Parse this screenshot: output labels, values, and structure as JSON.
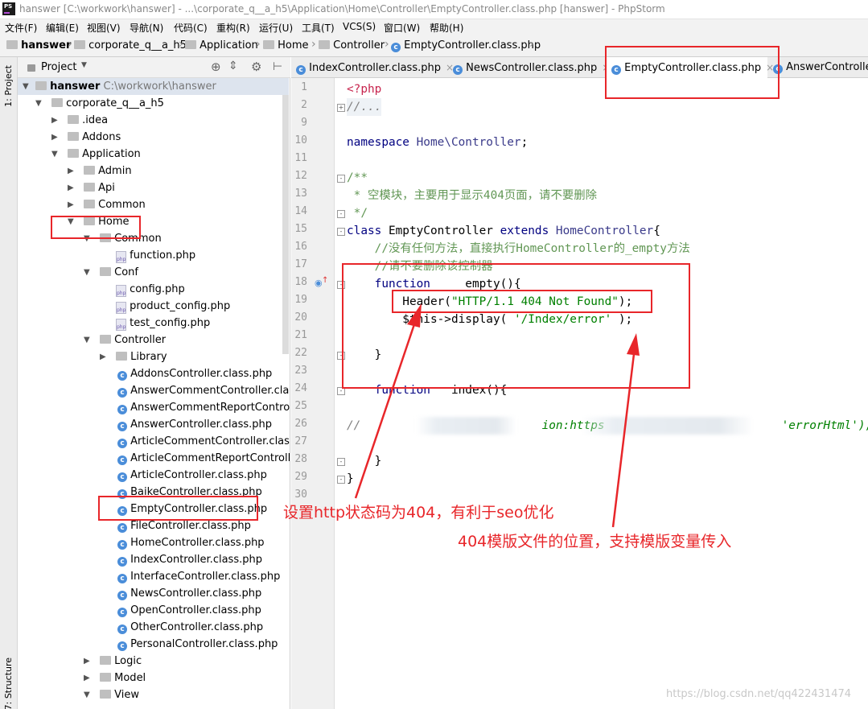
{
  "window": {
    "app_icon": "PS",
    "title": "hanswer [C:\\workwork\\hanswer] - ...\\corporate_q__a_h5\\Application\\Home\\Controller\\EmptyController.class.php [hanswer] - PhpStorm"
  },
  "menu": [
    "文件(F)",
    "编辑(E)",
    "视图(V)",
    "导航(N)",
    "代码(C)",
    "重构(R)",
    "运行(U)",
    "工具(T)",
    "VCS(S)",
    "窗口(W)",
    "帮助(H)"
  ],
  "breadcrumb": [
    "hanswer",
    "corporate_q__a_h5",
    "Application",
    "Home",
    "Controller",
    "EmptyController.class.php"
  ],
  "side_tabs": {
    "project": "1: Project",
    "structure": "7: Structure"
  },
  "project_panel": {
    "label": "Project",
    "dropdown_icon": "chevron-down-icon"
  },
  "tree": {
    "root": {
      "name": "hanswer",
      "path": "C:\\workwork\\hanswer"
    },
    "corporate": "corporate_q__a_h5",
    "idea": ".idea",
    "addons": "Addons",
    "application": "Application",
    "admin": "Admin",
    "api": "Api",
    "common": "Common",
    "home": "Home",
    "home_common": "Common",
    "function_php": "function.php",
    "conf": "Conf",
    "config_php": "config.php",
    "product_config_php": "product_config.php",
    "test_config_php": "test_config.php",
    "controller": "Controller",
    "library": "Library",
    "controllers": [
      "AddonsController.class.php",
      "AnswerCommentController.class.php",
      "AnswerCommentReportController.class.php",
      "AnswerController.class.php",
      "ArticleCommentController.class.php",
      "ArticleCommentReportController.class.php",
      "ArticleController.class.php",
      "BaikeController.class.php",
      "EmptyController.class.php",
      "FileController.class.php",
      "HomeController.class.php",
      "IndexController.class.php",
      "InterfaceController.class.php",
      "NewsController.class.php",
      "OpenController.class.php",
      "OtherController.class.php",
      "PersonalController.class.php"
    ],
    "logic": "Logic",
    "model": "Model",
    "view": "View"
  },
  "tabs": [
    {
      "label": "IndexController.class.php"
    },
    {
      "label": "NewsController.class.php"
    },
    {
      "label": "EmptyController.class.php",
      "active": true
    },
    {
      "label": "AnswerController."
    }
  ],
  "line_numbers": [
    "1",
    "2",
    "9",
    "10",
    "11",
    "12",
    "13",
    "14",
    "15",
    "16",
    "17",
    "18",
    "19",
    "20",
    "21",
    "22",
    "23",
    "24",
    "25",
    "26",
    "27",
    "28",
    "29",
    "30"
  ],
  "code": {
    "l1": "<?php",
    "l2": "//...",
    "l9": "",
    "l10a": "namespace ",
    "l10b": "Home\\Controller",
    "l10c": ";",
    "l12": "/**",
    "l13": " * 空模块，主要用于显示404页面，请不要删除",
    "l14": " */",
    "l15a": "class ",
    "l15b": "EmptyController ",
    "l15c": "extends ",
    "l15d": "HomeController",
    "l15e": "{",
    "l16": "    //没有任何方法，直接执行HomeController的_empty方法",
    "l17": "    //请不要删除该控制器",
    "l18a": "    function ",
    "l18b": "   _empty(){",
    "l19a": "        Header(",
    "l19b": "\"HTTP/1.1 404 Not Found\"",
    "l19c": ");",
    "l20a": "        $this->display( ",
    "l20b": "'/Index/error'",
    "l20c": " );",
    "l22": "    }",
    "l24a": "    function ",
    "l24b": "  index(){",
    "l26a": "//        ",
    "l26b": "                  ",
    "l26c": "ion:https",
    "l26d": "'errorHtml');",
    "l28": "    }",
    "l29": "}"
  },
  "annotations": {
    "a1": "设置http状态码为404，有利于seo优化",
    "a2": "404模版文件的位置，支持模版变量传入"
  },
  "watermark": "https://blog.csdn.net/qq422431474",
  "colors": {
    "annotation_red": "#e8262a",
    "keyword": "#000080",
    "string": "#008000"
  }
}
